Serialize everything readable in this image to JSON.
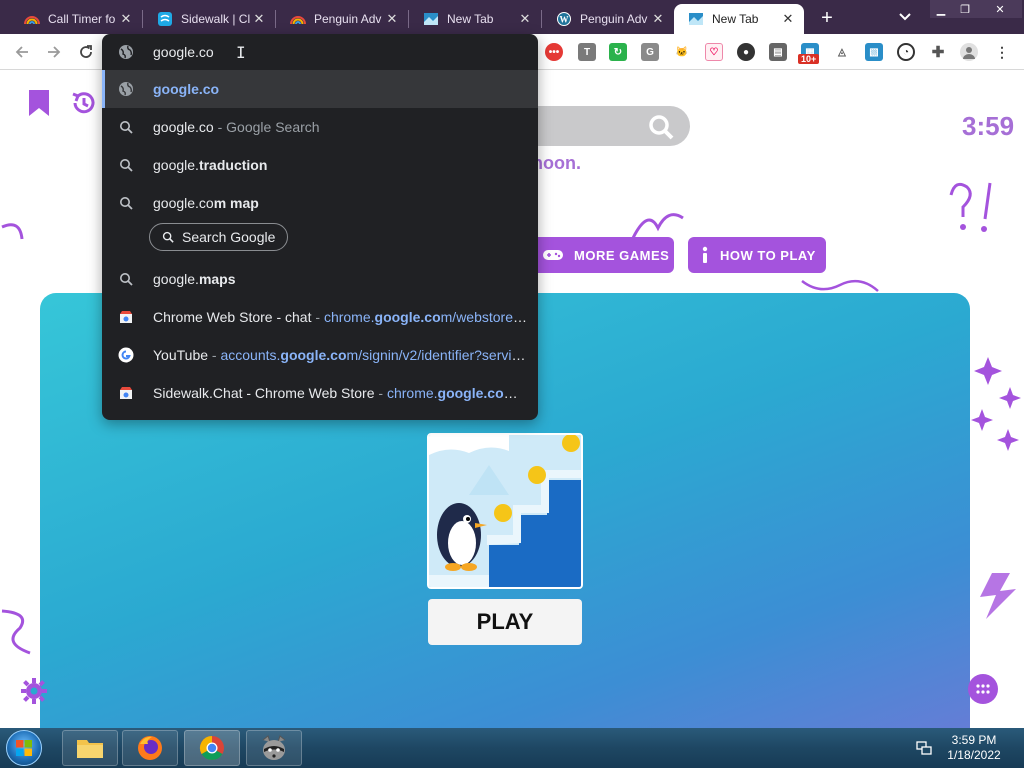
{
  "tabs": [
    {
      "title": "Call Timer fo",
      "active": false
    },
    {
      "title": "Sidewalk | Cl",
      "active": false
    },
    {
      "title": "Penguin Adv",
      "active": false
    },
    {
      "title": "New Tab",
      "active": false
    },
    {
      "title": "Penguin Adv",
      "active": false
    },
    {
      "title": "New Tab",
      "active": true
    }
  ],
  "omnibox": {
    "typed": "google.co",
    "rows": [
      {
        "pre": "google.co",
        "bold": "",
        "sep": "",
        "url": ""
      },
      {
        "pre": "google.co",
        "bold": "",
        "sep": " - ",
        "dim": "Google Search",
        "url": ""
      },
      {
        "pre": "google.",
        "bold": "traduction"
      },
      {
        "pre": "google.co",
        "bold": "m map"
      },
      {
        "pre": "google.",
        "bold": "maps"
      },
      {
        "title": "Chrome Web Store - chat",
        "sep": " - ",
        "url_pre": "chrome.",
        "url_bold": "google.co",
        "url_post": "m/webstore/..."
      },
      {
        "title": "YouTube",
        "sep": " - ",
        "url_pre": "accounts.",
        "url_bold": "google.co",
        "url_post": "m/signin/v2/identifier?servic..."
      },
      {
        "title": "Sidewalk.Chat - Chrome Web Store",
        "sep": " - ",
        "url_pre": "chrome.",
        "url_bold": "google.co",
        "url_post": "m/..."
      }
    ],
    "search_pill": "Search Google"
  },
  "page": {
    "clock": "3:59",
    "greeting": "noon.",
    "more_games": "MORE GAMES",
    "how_to_play": "HOW TO PLAY",
    "play": "PLAY"
  },
  "extensions": {
    "badge": "10+"
  },
  "taskbar": {
    "time": "3:59 PM",
    "date": "1/18/2022"
  },
  "colors": {
    "accent_purple": "#a453dd",
    "omnibox_bg": "#202124",
    "link_blue": "#8ab4f8",
    "tabstrip_bg": "#3a2a48"
  }
}
